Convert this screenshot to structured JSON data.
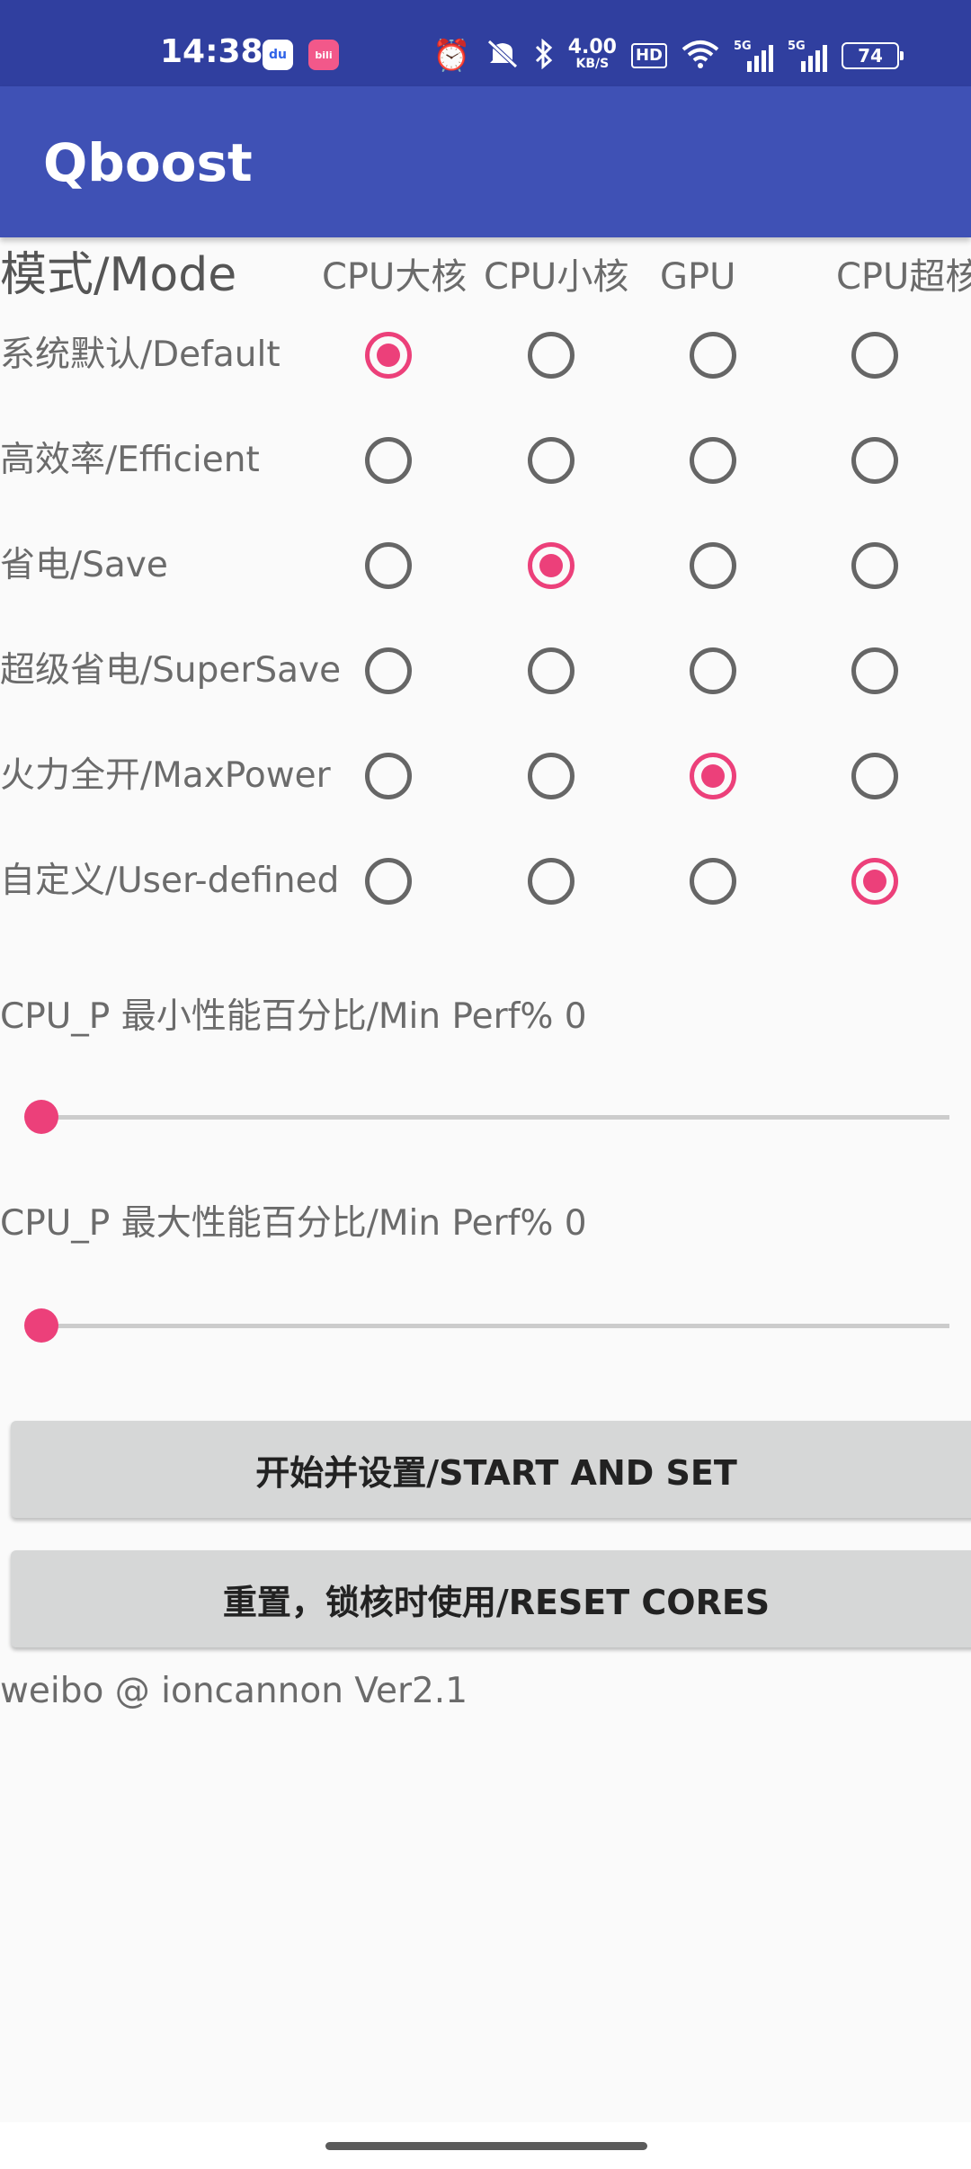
{
  "status_bar": {
    "time": "14:38",
    "notification_icons": [
      "baidu-icon",
      "bilibili-icon"
    ],
    "icons": [
      "alarm-icon",
      "mute-icon",
      "bluetooth-icon",
      "hd-icon",
      "wifi-icon",
      "signal-5g-icon",
      "signal-5g-icon",
      "battery-icon"
    ],
    "net_speed_value": "4.00",
    "net_speed_unit": "KB/S",
    "hd_label": "HD",
    "sim1_tag": "5G",
    "sim2_tag": "5G",
    "battery_level": "74"
  },
  "app_bar": {
    "title": "Qboost"
  },
  "mode_grid": {
    "title": "模式/Mode",
    "columns": [
      "CPU大核",
      "CPU小核",
      "GPU",
      "CPU超核"
    ],
    "rows": [
      {
        "label": "系统默认/Default",
        "selected_column": 0
      },
      {
        "label": "高效率/Efficient",
        "selected_column": null
      },
      {
        "label": "省电/Save",
        "selected_column": 1
      },
      {
        "label": "超级省电/SuperSave",
        "selected_column": null
      },
      {
        "label": "火力全开/MaxPower",
        "selected_column": 2
      },
      {
        "label": "自定义/User-defined",
        "selected_column": 3
      }
    ]
  },
  "sliders": [
    {
      "label": "CPU_P 最小性能百分比/Min Perf% 0",
      "value": 0
    },
    {
      "label": "CPU_P 最大性能百分比/Min Perf% 0",
      "value": 0
    }
  ],
  "buttons": {
    "start_label": "开始并设置/START AND SET",
    "reset_label": "重置，锁核时使用/RESET CORES"
  },
  "footer": {
    "credit": "weibo @ ioncannon Ver2.1"
  },
  "colors": {
    "status_bar": "#303f9f",
    "app_bar": "#3f51b5",
    "accent": "#ec407a",
    "background": "#fafafa",
    "button": "#d6d7d7"
  }
}
